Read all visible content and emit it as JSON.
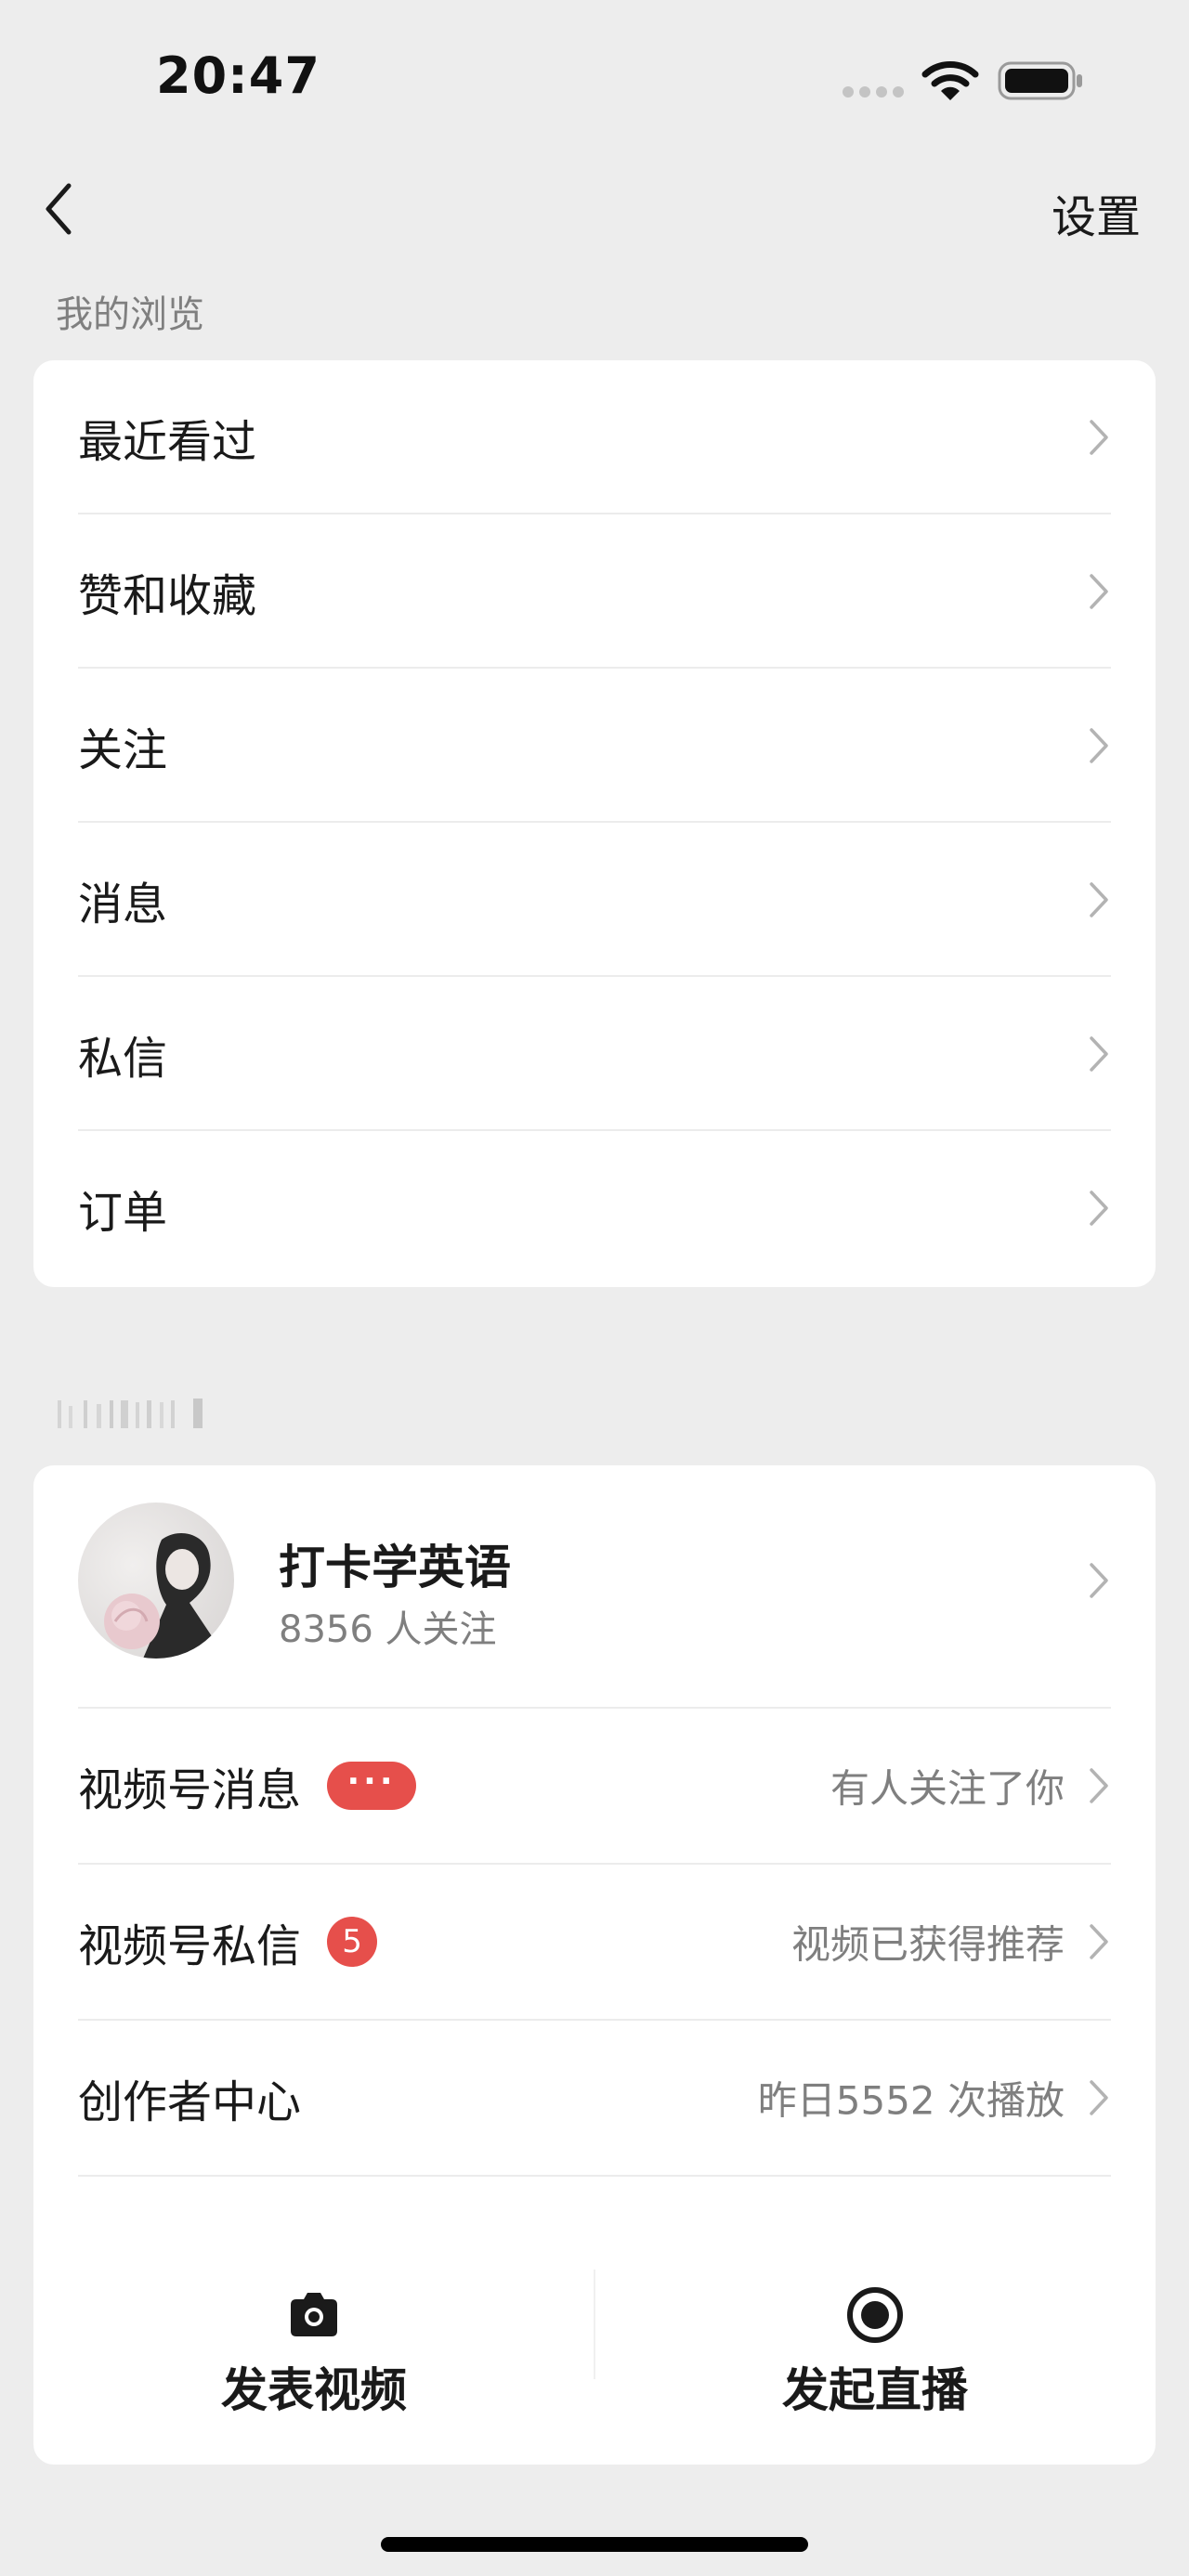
{
  "status_bar": {
    "time": "20:47"
  },
  "nav": {
    "back_icon": "chevron-left-icon",
    "settings_label": "设置"
  },
  "browse_section": {
    "title": "我的浏览",
    "items": [
      {
        "label": "最近看过"
      },
      {
        "label": "赞和收藏"
      },
      {
        "label": "关注"
      },
      {
        "label": "消息"
      },
      {
        "label": "私信"
      },
      {
        "label": "订单"
      }
    ]
  },
  "channel_section": {
    "profile": {
      "name": "打卡学英语",
      "followers": "8356 人关注"
    },
    "rows": [
      {
        "label": "视频号消息",
        "badge": "···",
        "detail": "有人关注了你"
      },
      {
        "label": "视频号私信",
        "badge": "5",
        "detail": "视频已获得推荐"
      },
      {
        "label": "创作者中心",
        "detail": "昨日5552 次播放"
      }
    ],
    "actions": [
      {
        "label": "发表视频",
        "icon": "camera-icon"
      },
      {
        "label": "发起直播",
        "icon": "record-icon"
      }
    ]
  },
  "colors": {
    "background": "#ededed",
    "card": "#ffffff",
    "badge_red": "#e64f4b",
    "secondary_text": "#7f7f7f"
  }
}
